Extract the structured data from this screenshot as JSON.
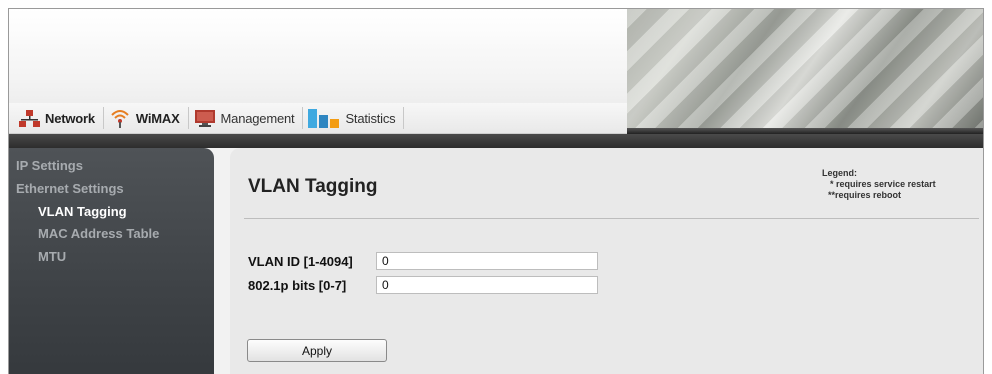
{
  "tabs": [
    {
      "label": "Network",
      "icon": "network-icon"
    },
    {
      "label": "WiMAX",
      "icon": "wimax-signal-icon"
    },
    {
      "label": "Management",
      "icon": "management-monitor-icon"
    },
    {
      "label": "Statistics",
      "icon": "statistics-chart-icon"
    }
  ],
  "sidebar": {
    "items": [
      {
        "label": "IP Settings",
        "active": false
      },
      {
        "label": "Ethernet Settings",
        "active": false
      },
      {
        "label": "VLAN Tagging",
        "active": true
      },
      {
        "label": "MAC Address Table",
        "active": false
      },
      {
        "label": "MTU",
        "active": false
      }
    ]
  },
  "main": {
    "title": "VLAN Tagging",
    "legend": {
      "heading": "Legend:",
      "single_mark": "*",
      "single_text": "requires service restart",
      "double_mark": "**",
      "double_text": "requires reboot"
    },
    "fields": [
      {
        "label": "VLAN ID [1-4094]",
        "value": "0"
      },
      {
        "label": "802.1p bits [0-7]",
        "value": "0"
      }
    ],
    "apply_label": "Apply"
  },
  "colors": {
    "sidebar_bg": "#45494d",
    "active_text": "#ffffff",
    "inactive_text": "#a7abaf",
    "content_bg": "#e9e9e9"
  }
}
